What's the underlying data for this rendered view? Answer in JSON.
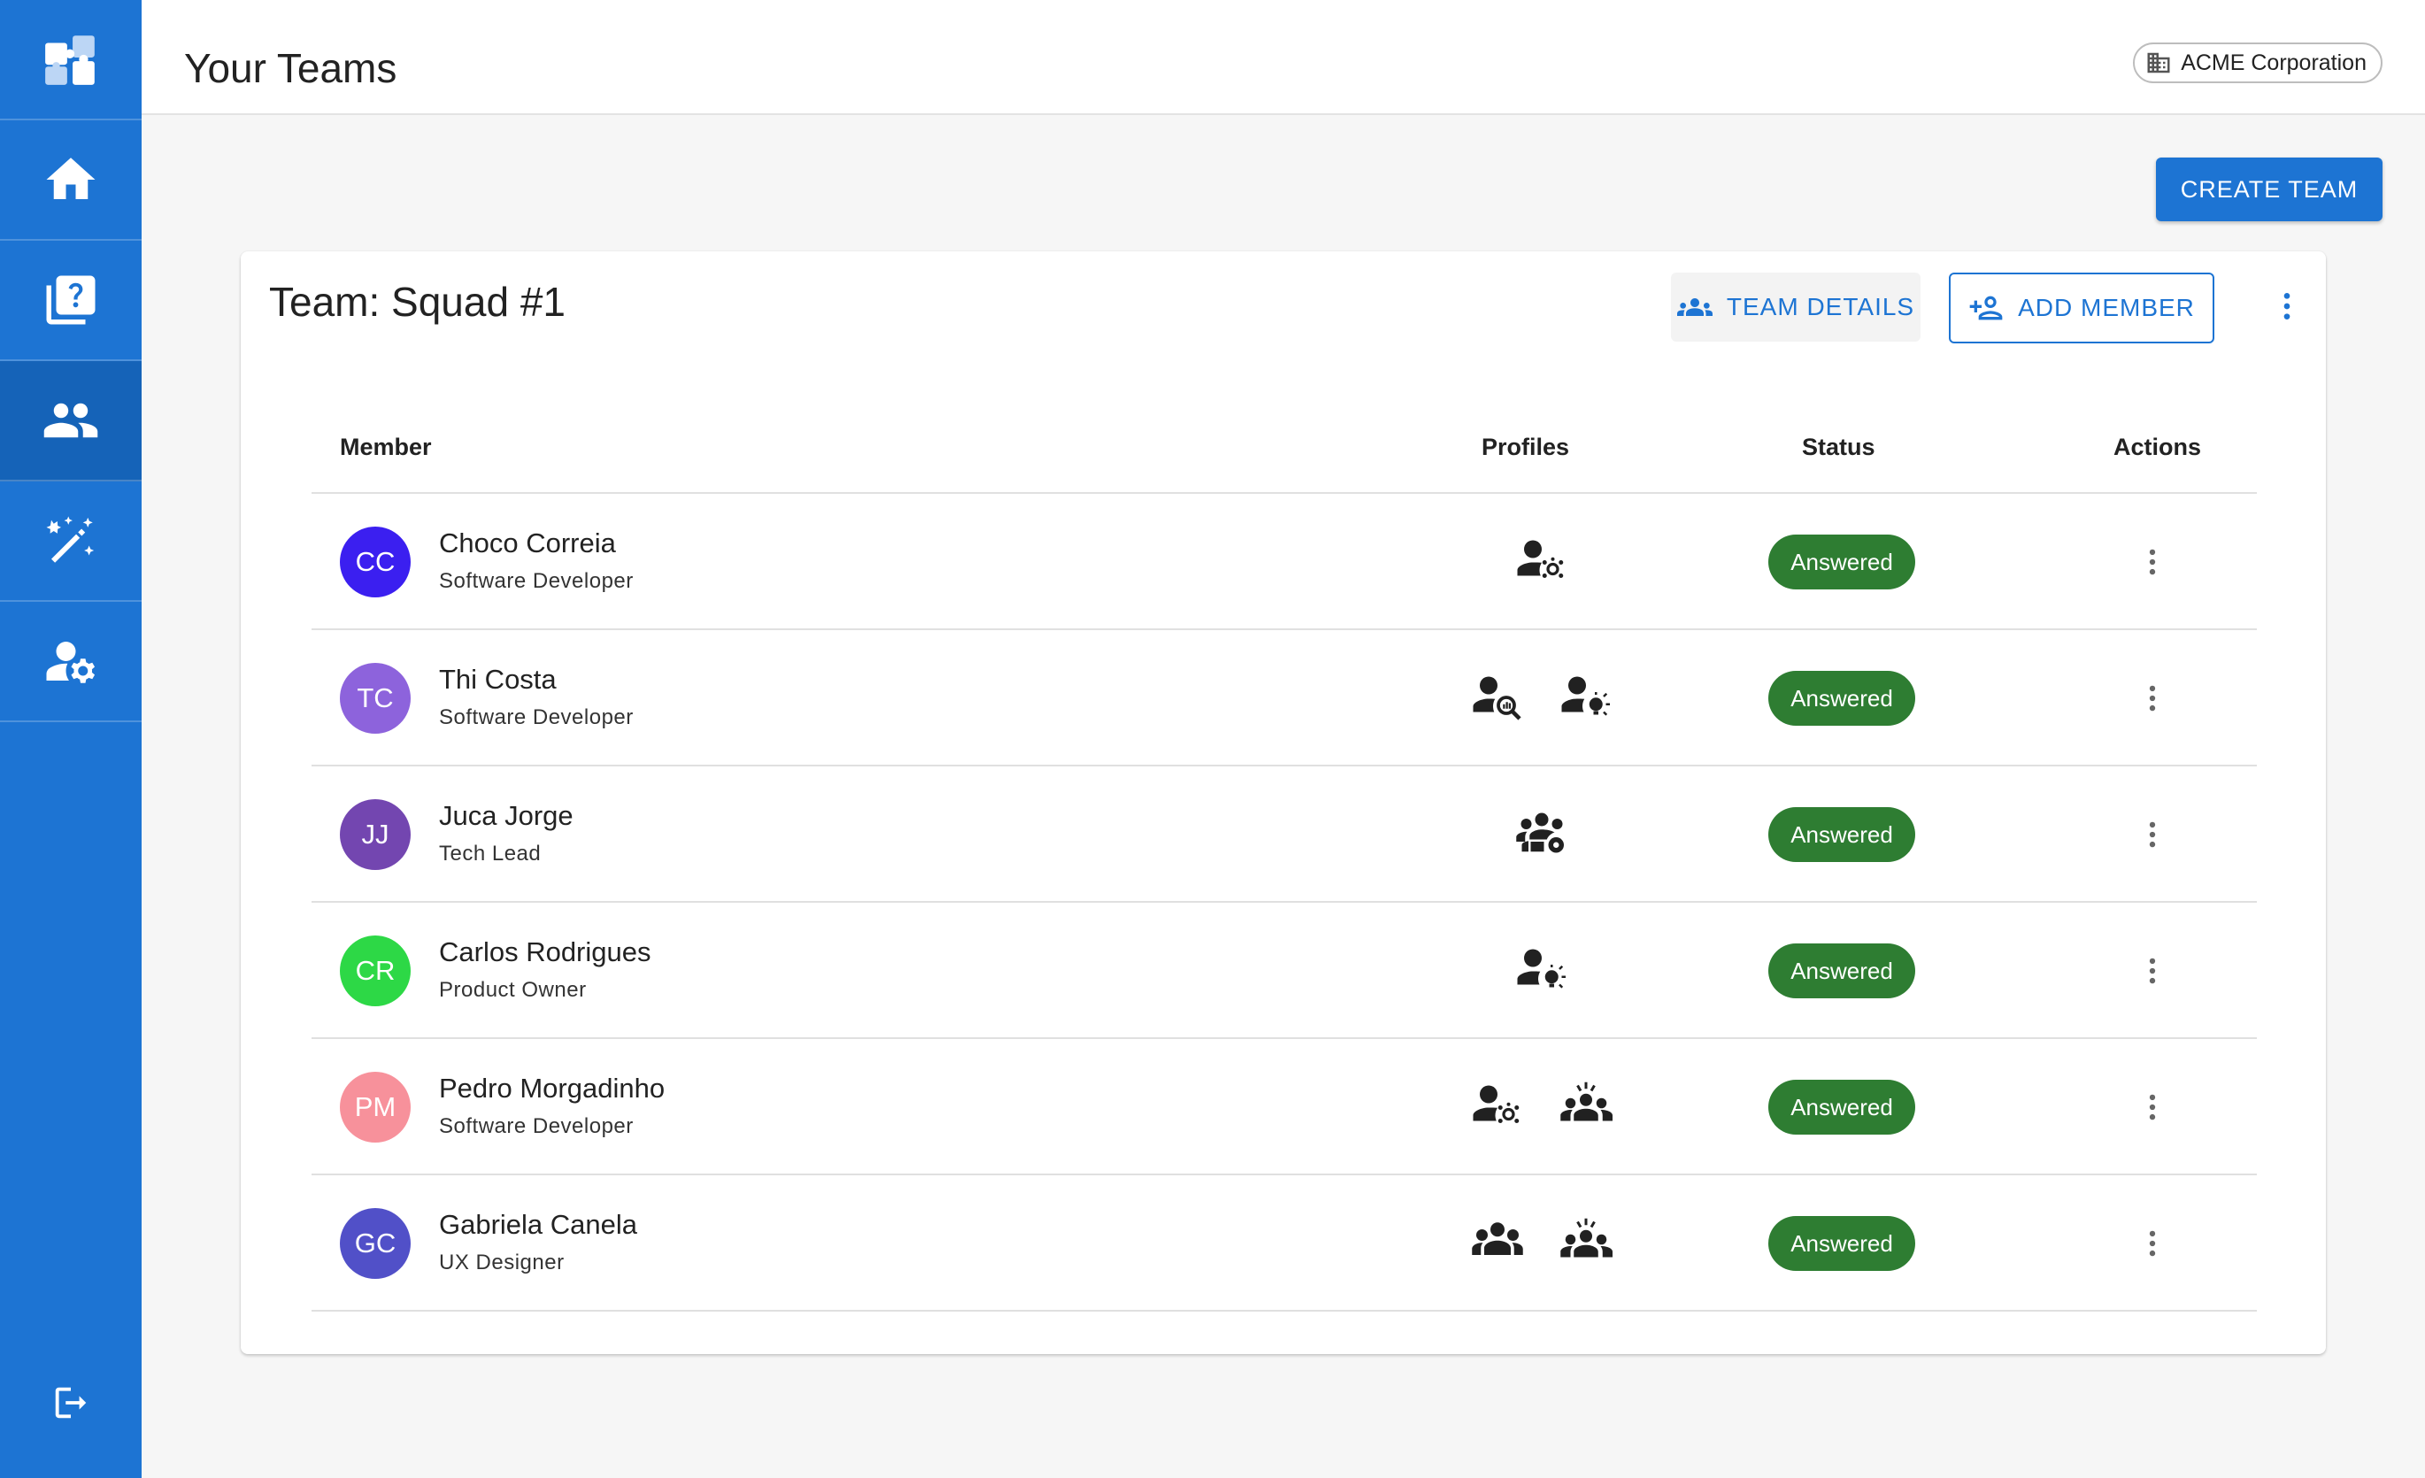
{
  "header": {
    "title": "Your Teams",
    "org_name": "ACME Corporation"
  },
  "actions": {
    "create_team": "CREATE TEAM"
  },
  "team": {
    "title": "Team: Squad #1",
    "details_label": "TEAM DETAILS",
    "add_member_label": "ADD MEMBER"
  },
  "table": {
    "columns": [
      "Member",
      "Profiles",
      "Status",
      "Actions"
    ],
    "rows": [
      {
        "initials": "CC",
        "avatar_color": "#3b1ff0",
        "name": "Choco Correia",
        "role": "Software Developer",
        "profiles": [
          "person-network-icon"
        ],
        "status": "Answered"
      },
      {
        "initials": "TC",
        "avatar_color": "#8d63dc",
        "name": "Thi Costa",
        "role": "Software Developer",
        "profiles": [
          "person-search-chart-icon",
          "person-idea-icon"
        ],
        "status": "Answered"
      },
      {
        "initials": "JJ",
        "avatar_color": "#7346b0",
        "name": "Juca Jorge",
        "role": "Tech Lead",
        "profiles": [
          "group-settings-icon"
        ],
        "status": "Answered"
      },
      {
        "initials": "CR",
        "avatar_color": "#2dd846",
        "name": "Carlos Rodrigues",
        "role": "Product Owner",
        "profiles": [
          "person-idea-icon"
        ],
        "status": "Answered"
      },
      {
        "initials": "PM",
        "avatar_color": "#f7919b",
        "name": "Pedro Morgadinho",
        "role": "Software Developer",
        "profiles": [
          "person-network-icon",
          "group-celebrate-icon"
        ],
        "status": "Answered"
      },
      {
        "initials": "GC",
        "avatar_color": "#5150c8",
        "name": "Gabriela Canela",
        "role": "UX Designer",
        "profiles": [
          "group-icon",
          "group-celebrate-icon"
        ],
        "status": "Answered"
      }
    ]
  },
  "colors": {
    "primary": "#1d74d3",
    "status_answered": "#2e7d32"
  }
}
